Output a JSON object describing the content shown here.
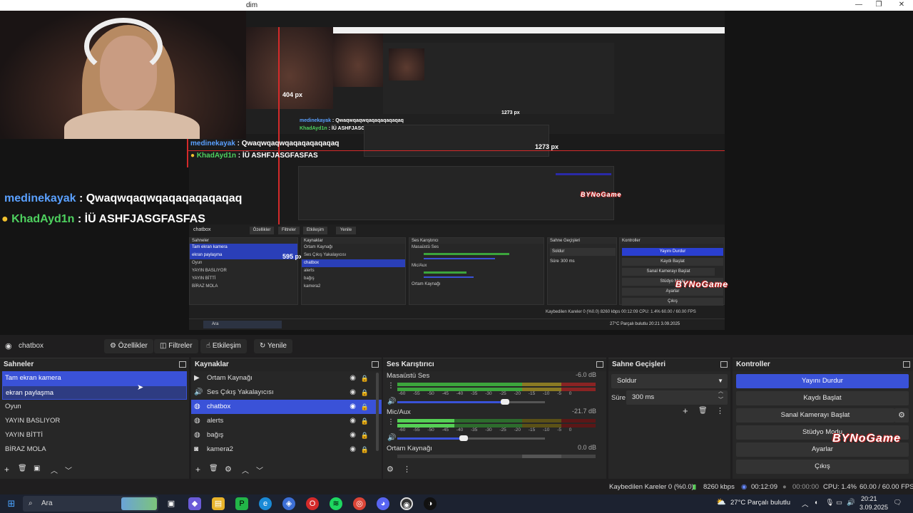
{
  "window": {
    "title": "dim",
    "controls": {
      "minimize": "—",
      "maximize": "❐",
      "close": "✕"
    }
  },
  "preview": {
    "chat_large": [
      {
        "user": "medinekayak",
        "sep": " : ",
        "text": "Qwaqwqaqwqaqaqaqaqaqaq"
      },
      {
        "user": "KhadAyd1n",
        "sep": " : ",
        "text": "İÜ ASHFJASGFASFAS"
      }
    ],
    "chat_mid": [
      {
        "user": "medinekayak",
        "sep": " : ",
        "text": "Qwaqwqaqwqaqaqaqaqaqaq"
      },
      {
        "user": "KhadAyd1n",
        "sep": " : ",
        "text": "İÜ ASHFJASGFASFAS"
      }
    ],
    "chat_small": [
      {
        "user": "medinekayak",
        "sep": " : ",
        "text": "Qwaqwqaqwqaqaqaqaqaqaq"
      },
      {
        "user": "KhadAyd1n",
        "sep": " : ",
        "text": "İÜ ASHFJASGFASFAS"
      }
    ],
    "px_labels": [
      "404 px",
      "595 px",
      "1273 px",
      "1273 px"
    ],
    "mini_obs": {
      "source_name": "chatbox",
      "toolbar": [
        "Özellikler",
        "Filtreler",
        "Etkileşim",
        "Yenile"
      ],
      "scenes_title": "Sahneler",
      "scenes": [
        "Tam ekran kamera",
        "ekran paylaşma",
        "Oyun",
        "YAYIN BASLIYOR",
        "YAYIN BİTTİ",
        "BİRAZ MOLA"
      ],
      "sources_title": "Kaynaklar",
      "sources": [
        "Ortam Kaynağı",
        "Ses Çıkış Yakalayıcısı",
        "chatbox",
        "alerts",
        "bağış",
        "kamera2"
      ],
      "mixer_title": "Ses Karıştırıcı",
      "mixer": [
        "Masaüstü Ses",
        "Mic/Aux",
        "Ortam Kaynağı"
      ],
      "transitions_title": "Sahne Geçişleri",
      "transition": "Soldur",
      "duration_label": "Süre",
      "duration": "300 ms",
      "controls_title": "Kontroller",
      "controls": [
        "Yayını Durdur",
        "Kaydı Başlat",
        "Sanal Kamerayı Başlat",
        "Stüdyo Modu",
        "Ayarlar",
        "Çıkış"
      ],
      "status": "Kaybedilen Kareler 0 (%0.0)   8260 kbps   00:12:09   CPU: 1.4%   60.00 / 60.00 FPS",
      "search": "Ara",
      "tray": "27°C Parçalı bulutlu   20:21 3.09.2025"
    },
    "watermark": "BYNoGame"
  },
  "toolbar": {
    "source_name": "chatbox",
    "properties": "Özellikler",
    "filters": "Filtreler",
    "interact": "Etkileşim",
    "refresh": "Yenile"
  },
  "scenes": {
    "title": "Sahneler",
    "items": [
      "Tam ekran kamera",
      "ekran paylaşma",
      "Oyun",
      "YAYIN BASLIYOR",
      "YAYIN BİTTİ",
      "BİRAZ MOLA"
    ]
  },
  "sources": {
    "title": "Kaynaklar",
    "items": [
      {
        "name": "Ortam Kaynağı",
        "icon": "play-icon"
      },
      {
        "name": "Ses Çıkış Yakalayıcısı",
        "icon": "speaker-icon"
      },
      {
        "name": "chatbox",
        "icon": "globe-icon"
      },
      {
        "name": "alerts",
        "icon": "globe-icon"
      },
      {
        "name": "bağış",
        "icon": "globe-icon"
      },
      {
        "name": "kamera2",
        "icon": "camera-icon"
      }
    ]
  },
  "mixer": {
    "title": "Ses Karıştırıcı",
    "scale": "-60 -55 -50 -45 -40 -35 -30 -25 -20 -15 -10 -5 0",
    "channels": [
      {
        "name": "Masaüstü Ses",
        "db": "-6.0 dB",
        "volume": 0.73
      },
      {
        "name": "Mic/Aux",
        "db": "-21.7 dB",
        "volume": 0.45
      },
      {
        "name": "Ortam Kaynağı",
        "db": "0.0 dB",
        "volume": 1.0
      }
    ]
  },
  "transitions": {
    "title": "Sahne Geçişleri",
    "selected": "Soldur",
    "duration_label": "Süre",
    "duration": "300 ms"
  },
  "controls": {
    "title": "Kontroller",
    "stop_stream": "Yayını Durdur",
    "start_record": "Kaydı Başlat",
    "virtual_cam": "Sanal Kamerayı Başlat",
    "studio_mode": "Stüdyo Modu",
    "settings": "Ayarlar",
    "exit": "Çıkış"
  },
  "status": {
    "dropped_frames": "Kaybedilen Kareler 0 (%0.0)",
    "bitrate": "8260 kbps",
    "stream_time": "00:12:09",
    "record_time": "00:00:00",
    "cpu": "CPU: 1.4%",
    "fps": "60.00 / 60.00 FPS"
  },
  "taskbar": {
    "search_placeholder": "Ara",
    "weather": "27°C  Parçalı bulutlu",
    "time": "20:21",
    "date": "3.09.2025"
  },
  "colors": {
    "accent": "#3a52d8",
    "chat_user1": "#5aa0ff",
    "chat_user2": "#4ed15f",
    "guide": "#d42a2a"
  }
}
